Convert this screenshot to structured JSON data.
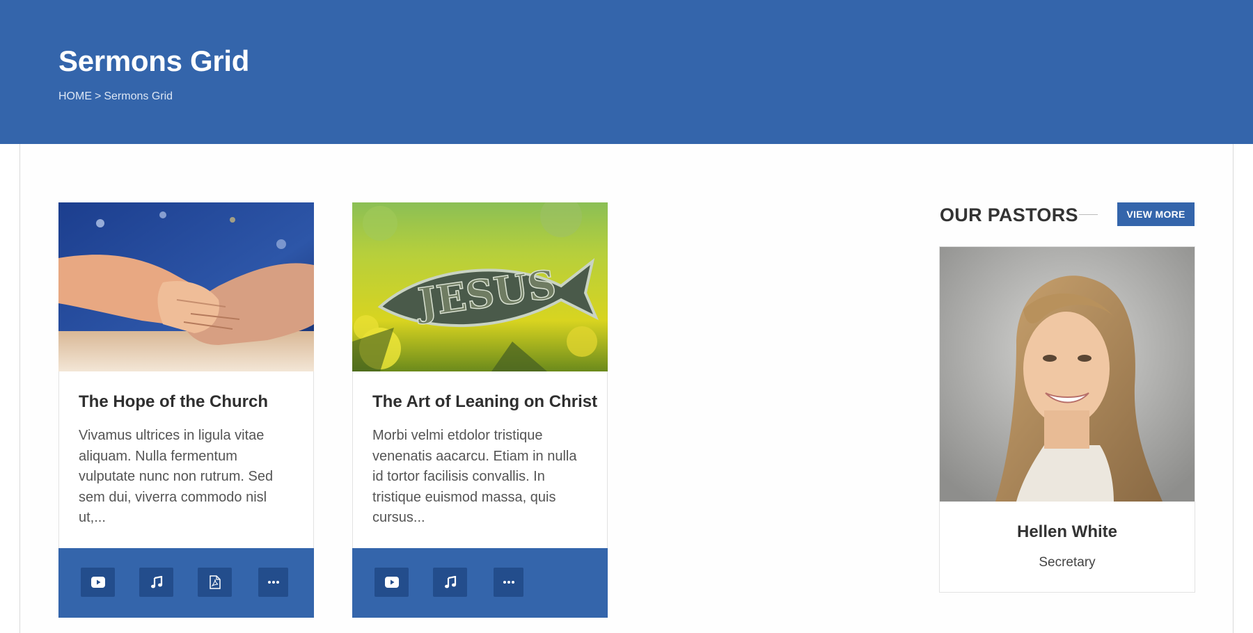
{
  "hero": {
    "title": "Sermons Grid",
    "breadcrumb": {
      "home": "HOME",
      "separator": ">",
      "current": "Sermons Grid"
    }
  },
  "sermons": [
    {
      "title": "The Hope of the Church",
      "excerpt": "Vivamus ultrices in ligula vitae aliquam. Nulla fermentum vulputate nunc non rutrum. Sed sem dui, viverra commodo nisl ut,...",
      "image": "holding-hands",
      "actions": [
        "play-icon",
        "music-icon",
        "pdf-icon",
        "more-icon"
      ]
    },
    {
      "title": "The Art of Leaning on Christ",
      "excerpt": "Morbi velmi etdolor tristique venenatis aacarcu. Etiam in nulla id tortor facilisis convallis. In tristique euismod massa, quis cursus...",
      "image": "jesus-fish-in-grass",
      "actions": [
        "play-icon",
        "music-icon",
        "more-icon"
      ]
    }
  ],
  "pastors": {
    "heading": "OUR PASTORS",
    "view_more": "VIEW MORE",
    "featured": {
      "name": "Hellen White",
      "role": "Secretary",
      "image": "pastor-portrait"
    }
  },
  "colors": {
    "brand": "#3465ab",
    "button_dark": "#234d8c"
  }
}
